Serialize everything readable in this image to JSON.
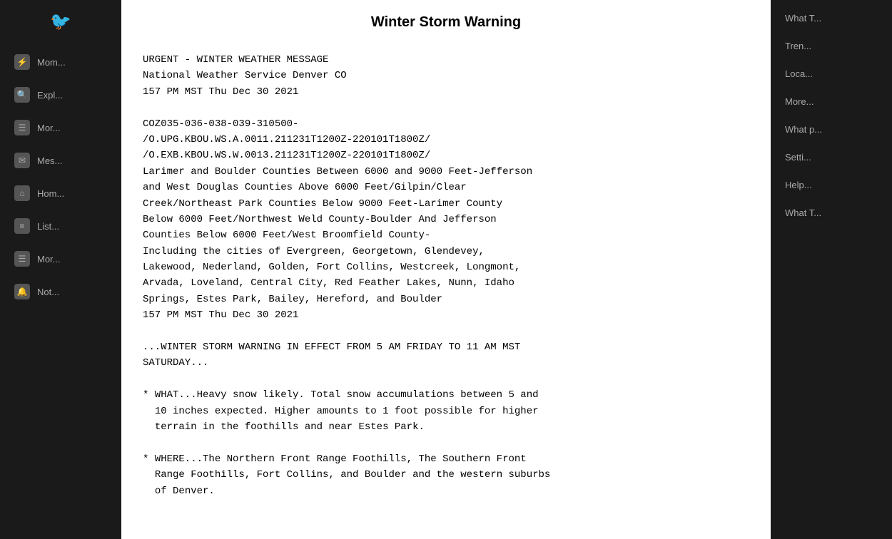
{
  "sidebar_left": {
    "twitter_icon": "🐦",
    "items": [
      {
        "id": "moments",
        "icon": "⚡",
        "label": "Mom..."
      },
      {
        "id": "explore",
        "icon": "🔍",
        "label": "Expl..."
      },
      {
        "id": "more1",
        "icon": "☰",
        "label": "Mor..."
      },
      {
        "id": "messages",
        "icon": "✉",
        "label": "Mes..."
      },
      {
        "id": "home",
        "icon": "🏠",
        "label": "Hom..."
      },
      {
        "id": "lists",
        "icon": "≡",
        "label": "List..."
      },
      {
        "id": "more2",
        "icon": "☰",
        "label": "Mor..."
      },
      {
        "id": "notifications",
        "icon": "🔔",
        "label": "Not..."
      }
    ]
  },
  "sidebar_right": {
    "items": [
      {
        "id": "what1",
        "label": "What T..."
      },
      {
        "id": "trending",
        "label": "Tren..."
      },
      {
        "id": "location",
        "label": "Loca..."
      },
      {
        "id": "more",
        "label": "More..."
      },
      {
        "id": "whatp",
        "label": "What p..."
      },
      {
        "id": "settings",
        "label": "Setti..."
      },
      {
        "id": "help",
        "label": "Help..."
      },
      {
        "id": "whatn",
        "label": "What T..."
      }
    ]
  },
  "modal": {
    "title": "Winter Storm Warning",
    "content": "URGENT - WINTER WEATHER MESSAGE\nNational Weather Service Denver CO\n157 PM MST Thu Dec 30 2021\n\nCOZ035-036-038-039-310500-\n/O.UPG.KBOU.WS.A.0011.211231T1200Z-220101T1800Z/\n/O.EXB.KBOU.WS.W.0013.211231T1200Z-220101T1800Z/\nLarimer and Boulder Counties Between 6000 and 9000 Feet-Jefferson\nand West Douglas Counties Above 6000 Feet/Gilpin/Clear\nCreek/Northeast Park Counties Below 9000 Feet-Larimer County\nBelow 6000 Feet/Northwest Weld County-Boulder And Jefferson\nCounties Below 6000 Feet/West Broomfield County-\nIncluding the cities of Evergreen, Georgetown, Glendevey,\nLakewood, Nederland, Golden, Fort Collins, Westcreek, Longmont,\nArvada, Loveland, Central City, Red Feather Lakes, Nunn, Idaho\nSprings, Estes Park, Bailey, Hereford, and Boulder\n157 PM MST Thu Dec 30 2021\n\n...WINTER STORM WARNING IN EFFECT FROM 5 AM FRIDAY TO 11 AM MST\nSATURDAY...\n\n* WHAT...Heavy snow likely. Total snow accumulations between 5 and\n  10 inches expected. Higher amounts to 1 foot possible for higher\n  terrain in the foothills and near Estes Park.\n\n* WHERE...The Northern Front Range Foothills, The Southern Front\n  Range Foothills, Fort Collins, and Boulder and the western suburbs\n  of Denver."
  }
}
